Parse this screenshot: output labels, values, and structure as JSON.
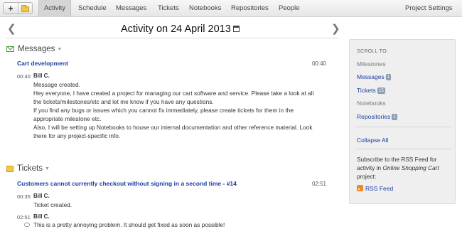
{
  "nav": {
    "tabs": [
      "Activity",
      "Schedule",
      "Messages",
      "Tickets",
      "Notebooks",
      "Repositories",
      "People"
    ],
    "active": "Activity",
    "settings": "Project Settings"
  },
  "heading": {
    "title": "Activity on 24 April 2013"
  },
  "messages": {
    "title": "Messages",
    "item": {
      "title": "Cart development",
      "time": "00:40",
      "entry": {
        "time": "00:40",
        "author": "Bill C.",
        "lines": [
          "Message created.",
          "Hey everyone, I have created a project for managing our cart software and service. Please take a look at all",
          "the tickets/milestones/etc and let me know if you have any questions.",
          "If you find any bugs or issues which you cannot fix immediately, please create tickets for them in the",
          "appropriate milestone etc.",
          "Also, I will be setting up Notebooks to house our internal documentation and other reference material. Look",
          "there for any project-specific info."
        ]
      }
    }
  },
  "tickets": {
    "title": "Tickets",
    "item": {
      "title": "Customers cannot currently checkout without signing in a second time - #14",
      "time": "02:51",
      "entries": [
        {
          "time": "00:35",
          "author": "Bill C.",
          "text": "Ticket created."
        },
        {
          "time": "02:51",
          "author": "Bill C.",
          "text": "This is a pretty annoying problem. It should get fixed as soon as possible!"
        }
      ]
    }
  },
  "sidebar": {
    "scroll_label": "SCROLL TO:",
    "milestones": "Milestones",
    "messages": "Messages",
    "messages_count": "1",
    "tickets": "Tickets",
    "tickets_count": "15",
    "notebooks": "Notebooks",
    "repositories": "Repositories",
    "repositories_count": "1",
    "collapse": "Collapse All",
    "rss_pre": "Subscribe to the RSS Feed for activity in ",
    "rss_project": "Online Shopping Cart",
    "rss_post": " project:",
    "rss_link": "RSS Feed"
  }
}
